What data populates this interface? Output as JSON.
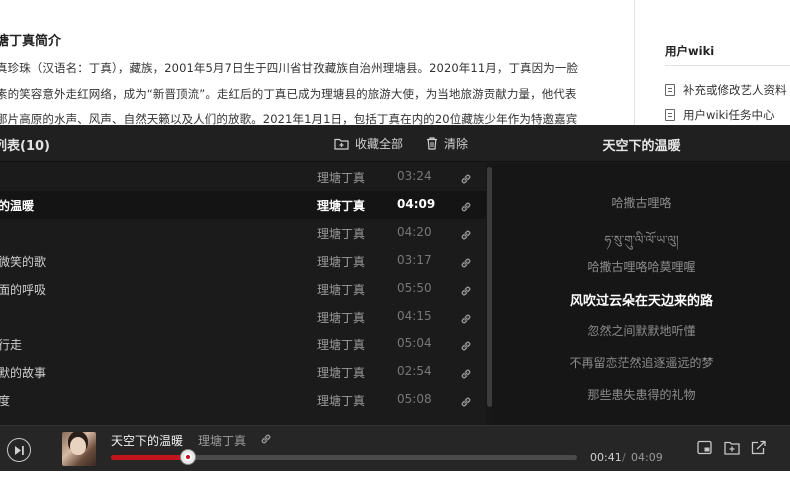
{
  "background": {
    "bio_title": "塘丁真简介",
    "bio_lines": [
      "真珍珠（汉语名：丁真），藏族，2001年5月7日生于四川省甘孜藏族自治州理塘县。2020年11月，丁真因为一脸",
      "素的笑容意外走红网络，成为“新晋顶流”。走红后的丁真已成为理塘县的旅游大使，为当地旅游贡献力量，他代表",
      "那片高原的水声、风声、自然天籁以及人们的放歌。2021年1月1日，包括丁真在内的20位藏族少年作为特邀嘉宾"
    ],
    "wiki_title": "用户wiki",
    "wiki_links": [
      "补充或修改艺人资料",
      "用户wiki任务中心"
    ]
  },
  "player": {
    "list_title": "列表(10)",
    "collect_all_label": "收藏全部",
    "clear_label": "清除",
    "lyric_title": "天空下的温暖",
    "tracks": [
      {
        "name": "",
        "artist": "理塘丁真",
        "duration": "03:24"
      },
      {
        "name": "的温暖",
        "artist": "理塘丁真",
        "duration": "04:09"
      },
      {
        "name": "",
        "artist": "理塘丁真",
        "duration": "04:20"
      },
      {
        "name": "微笑的歌",
        "artist": "理塘丁真",
        "duration": "03:17"
      },
      {
        "name": "面的呼吸",
        "artist": "理塘丁真",
        "duration": "05:50"
      },
      {
        "name": "",
        "artist": "理塘丁真",
        "duration": "04:15"
      },
      {
        "name": "行走",
        "artist": "理塘丁真",
        "duration": "05:04"
      },
      {
        "name": "默的故事",
        "artist": "理塘丁真",
        "duration": "02:54"
      },
      {
        "name": "度",
        "artist": "理塘丁真",
        "duration": "05:08"
      }
    ],
    "active_track_index": 1,
    "lyrics": [
      "哈撒古哩咯",
      "ཧ་སུ་གུ་ལི་ལོ་ཡ་ལུ།",
      "哈撒古哩咯哈莫哩喔",
      "风吹过云朵在天边来的路",
      "忽然之间默默地听懂",
      "不再留恋茫然追逐遥远的梦",
      "那些患失患得的礼物"
    ],
    "current_lyric_index": 3
  },
  "now_playing": {
    "title": "天空下的温暖",
    "artist": "理塘丁真",
    "current_time": "00:41",
    "separator": "/",
    "total_time": "04:09",
    "progress_fraction": 0.165
  },
  "colors": {
    "accent": "#c2141b",
    "panel": "#1b1b1b"
  }
}
